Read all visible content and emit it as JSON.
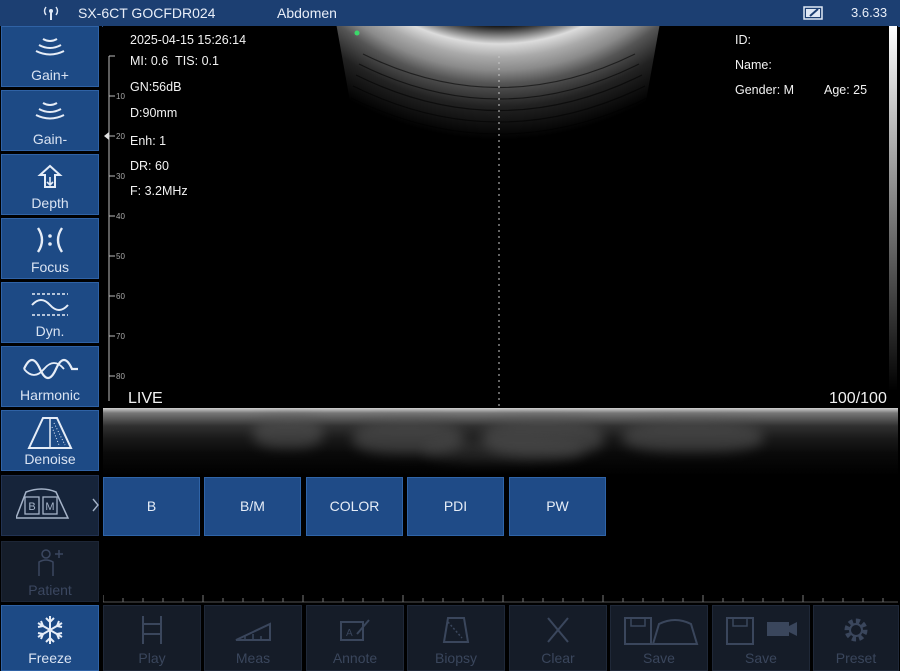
{
  "topbar": {
    "device": "SX-6CT GOCFDR024",
    "preset": "Abdomen",
    "version": "3.6.33",
    "icons": [
      "wifi-signal-icon",
      "battery-icon"
    ]
  },
  "sidebar": {
    "buttons": [
      {
        "label": "Gain+",
        "icon": "gain-up-icon"
      },
      {
        "label": "Gain-",
        "icon": "gain-down-icon"
      },
      {
        "label": "Depth",
        "icon": "depth-icon"
      },
      {
        "label": "Focus",
        "icon": "focus-icon"
      },
      {
        "label": "Dyn.",
        "icon": "dynamic-range-icon"
      },
      {
        "label": "Harmonic",
        "icon": "harmonic-wave-icon"
      },
      {
        "label": "Denoise",
        "icon": "denoise-icon"
      },
      {
        "label": "",
        "icon": "b-m-mode-icon"
      },
      {
        "label": "Patient",
        "icon": "patient-icon"
      },
      {
        "label": "Freeze",
        "icon": "snowflake-icon"
      }
    ],
    "mode_letters": [
      "B",
      "M"
    ]
  },
  "image": {
    "datetime": "2025-04-15 15:26:14",
    "mi": "MI: 0.6",
    "tis": "TIS: 0.1",
    "gain": "GN:56dB",
    "depth": "D:90mm",
    "enh": "Enh: 1",
    "dr": "DR: 60",
    "freq": "F: 3.2MHz",
    "live": "LIVE",
    "frame": "100/100",
    "scale_labels": [
      "10",
      "20",
      "30",
      "40",
      "50",
      "60",
      "70",
      "80"
    ],
    "patient": {
      "id": "ID:",
      "name": "Name:",
      "gender": "Gender: M",
      "age": "Age: 25"
    }
  },
  "modes": [
    "B",
    "B/M",
    "COLOR",
    "PDI",
    "PW"
  ],
  "bottom": [
    {
      "label": "Freeze",
      "icon": "snowflake-icon",
      "enabled": true
    },
    {
      "label": "Play",
      "icon": "play-film-icon",
      "enabled": false
    },
    {
      "label": "Meas",
      "icon": "measure-ruler-icon",
      "enabled": false
    },
    {
      "label": "Annote",
      "icon": "annotate-icon",
      "enabled": false
    },
    {
      "label": "Biopsy",
      "icon": "biopsy-icon",
      "enabled": false
    },
    {
      "label": "Clear",
      "icon": "clear-x-icon",
      "enabled": false
    },
    {
      "label": "Save",
      "icon": "save-image-icon",
      "enabled": false
    },
    {
      "label": "Save",
      "icon": "save-video-icon",
      "enabled": false
    },
    {
      "label": "Preset",
      "icon": "gear-icon",
      "enabled": false
    }
  ]
}
